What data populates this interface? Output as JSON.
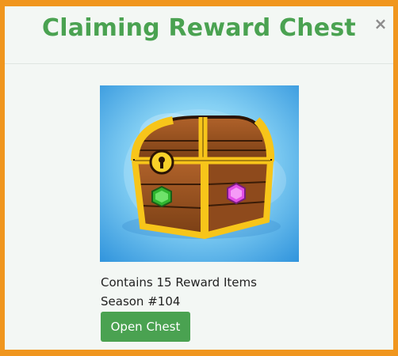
{
  "modal": {
    "title": "Claiming Reward Chest",
    "close_glyph": "×",
    "close_icon": "close-icon"
  },
  "chest": {
    "image_semantic": "treasure-chest-image",
    "gem_left_color": "#2fb52f",
    "gem_right_color": "#e24fe6"
  },
  "info": {
    "items_text": "Contains 15 Reward Items",
    "season_text": "Season #104"
  },
  "actions": {
    "open_label": "Open Chest"
  },
  "colors": {
    "frame": "#f0961e",
    "title": "#4aa251",
    "button": "#4aa251",
    "background": "#f3f7f4"
  }
}
